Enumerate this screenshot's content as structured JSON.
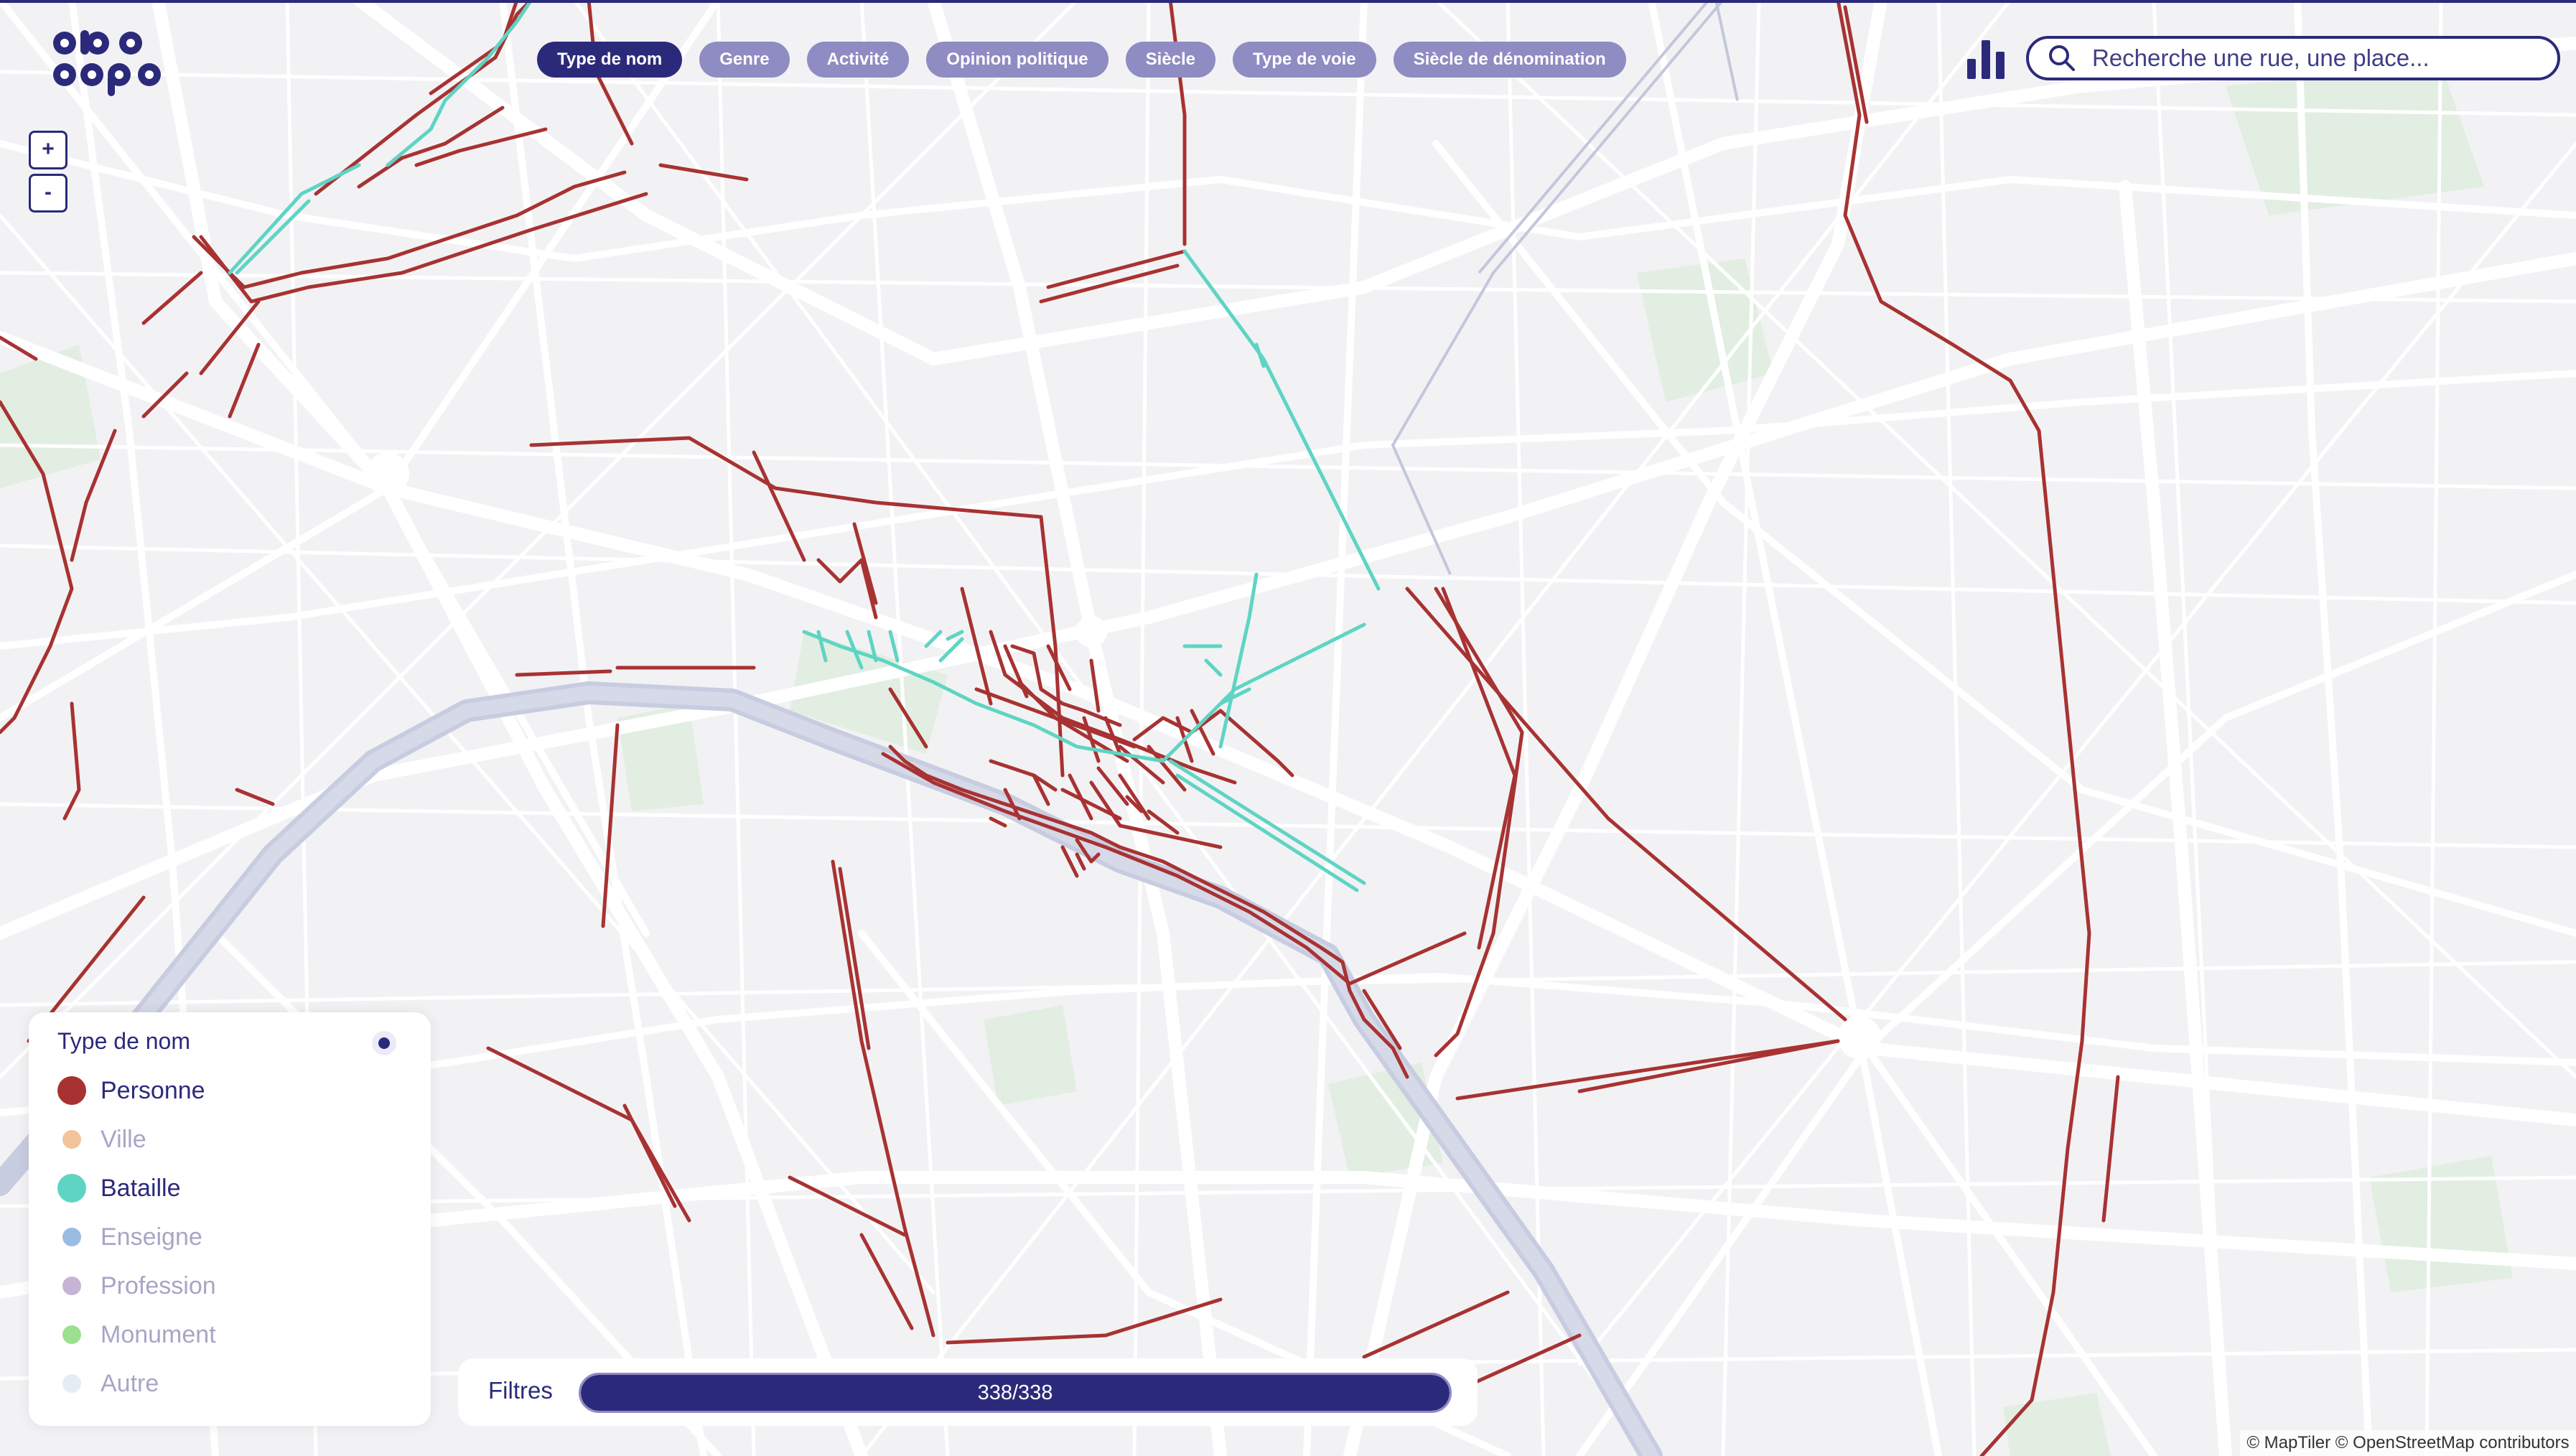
{
  "app": {
    "logo_text": "odo dapa"
  },
  "toolbar": {
    "chips": [
      {
        "label": "Type de nom",
        "active": true
      },
      {
        "label": "Genre",
        "active": false
      },
      {
        "label": "Activité",
        "active": false
      },
      {
        "label": "Opinion politique",
        "active": false
      },
      {
        "label": "Siècle",
        "active": false
      },
      {
        "label": "Type de voie",
        "active": false
      },
      {
        "label": "Siècle de dénomination",
        "active": false
      }
    ],
    "stats_icon": "bar-chart-icon"
  },
  "search": {
    "placeholder": "Recherche une rue, une place...",
    "value": "",
    "icon": "search-icon"
  },
  "zoom": {
    "in_label": "+",
    "out_label": "-"
  },
  "legend": {
    "title": "Type de nom",
    "items": [
      {
        "label": "Personne",
        "color": "#a83232",
        "enabled": true
      },
      {
        "label": "Ville",
        "color": "#f3c49a",
        "enabled": false
      },
      {
        "label": "Bataille",
        "color": "#5fd4c4",
        "enabled": true
      },
      {
        "label": "Enseigne",
        "color": "#9bbbe3",
        "enabled": false
      },
      {
        "label": "Profession",
        "color": "#c7b3d6",
        "enabled": false
      },
      {
        "label": "Monument",
        "color": "#9be08e",
        "enabled": false
      },
      {
        "label": "Autre",
        "color": "#e4eef2",
        "enabled": false
      }
    ]
  },
  "filters": {
    "label": "Filtres",
    "count_text": "338/338",
    "count": 338,
    "total": 338
  },
  "attribution": "© MapTiler © OpenStreetMap contributors",
  "colors": {
    "accent": "#2b2a7a",
    "chip_inactive": "#8f8bc3",
    "street_personne": "#a83232",
    "street_bataille": "#5fd4c4",
    "river": "#c8cce0",
    "park": "#e3efe3"
  }
}
